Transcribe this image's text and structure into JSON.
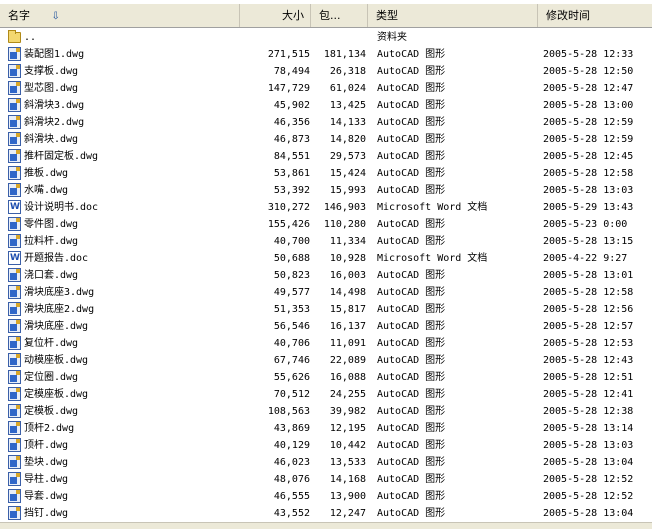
{
  "columns": {
    "name": "名字",
    "size": "大小",
    "packed": "包...",
    "type": "类型",
    "modified": "修改时间"
  },
  "files": [
    {
      "icon": "folder-icon",
      "kind": "folder",
      "name": "..",
      "size": "",
      "packed": "",
      "type": "资料夹",
      "modified": ""
    },
    {
      "icon": "dwg-file-icon",
      "kind": "dwg",
      "name": "装配图1.dwg",
      "size": "271,515",
      "packed": "181,134",
      "type": "AutoCAD 图形",
      "modified": "2005-5-28 12:33"
    },
    {
      "icon": "dwg-file-icon",
      "kind": "dwg",
      "name": "支撑板.dwg",
      "size": "78,494",
      "packed": "26,318",
      "type": "AutoCAD 图形",
      "modified": "2005-5-28 12:50"
    },
    {
      "icon": "dwg-file-icon",
      "kind": "dwg",
      "name": "型芯图.dwg",
      "size": "147,729",
      "packed": "61,024",
      "type": "AutoCAD 图形",
      "modified": "2005-5-28 12:47"
    },
    {
      "icon": "dwg-file-icon",
      "kind": "dwg",
      "name": "斜滑块3.dwg",
      "size": "45,902",
      "packed": "13,425",
      "type": "AutoCAD 图形",
      "modified": "2005-5-28 13:00"
    },
    {
      "icon": "dwg-file-icon",
      "kind": "dwg",
      "name": "斜滑块2.dwg",
      "size": "46,356",
      "packed": "14,133",
      "type": "AutoCAD 图形",
      "modified": "2005-5-28 12:59"
    },
    {
      "icon": "dwg-file-icon",
      "kind": "dwg",
      "name": "斜滑块.dwg",
      "size": "46,873",
      "packed": "14,820",
      "type": "AutoCAD 图形",
      "modified": "2005-5-28 12:59"
    },
    {
      "icon": "dwg-file-icon",
      "kind": "dwg",
      "name": "推杆固定板.dwg",
      "size": "84,551",
      "packed": "29,573",
      "type": "AutoCAD 图形",
      "modified": "2005-5-28 12:45"
    },
    {
      "icon": "dwg-file-icon",
      "kind": "dwg",
      "name": "推板.dwg",
      "size": "53,861",
      "packed": "15,424",
      "type": "AutoCAD 图形",
      "modified": "2005-5-28 12:58"
    },
    {
      "icon": "dwg-file-icon",
      "kind": "dwg",
      "name": "水嘴.dwg",
      "size": "53,392",
      "packed": "15,993",
      "type": "AutoCAD 图形",
      "modified": "2005-5-28 13:03"
    },
    {
      "icon": "word-file-icon",
      "kind": "doc",
      "name": "设计说明书.doc",
      "size": "310,272",
      "packed": "146,903",
      "type": "Microsoft Word 文档",
      "modified": "2005-5-29 13:43"
    },
    {
      "icon": "dwg-file-icon",
      "kind": "dwg",
      "name": "零件图.dwg",
      "size": "155,426",
      "packed": "110,280",
      "type": "AutoCAD 图形",
      "modified": "2005-5-23 0:00"
    },
    {
      "icon": "dwg-file-icon",
      "kind": "dwg",
      "name": "拉料杆.dwg",
      "size": "40,700",
      "packed": "11,334",
      "type": "AutoCAD 图形",
      "modified": "2005-5-28 13:15"
    },
    {
      "icon": "word-file-icon",
      "kind": "doc",
      "name": "开题报告.doc",
      "size": "50,688",
      "packed": "10,928",
      "type": "Microsoft Word 文档",
      "modified": "2005-4-22 9:27"
    },
    {
      "icon": "dwg-file-icon",
      "kind": "dwg",
      "name": "浇口套.dwg",
      "size": "50,823",
      "packed": "16,003",
      "type": "AutoCAD 图形",
      "modified": "2005-5-28 13:01"
    },
    {
      "icon": "dwg-file-icon",
      "kind": "dwg",
      "name": "滑块底座3.dwg",
      "size": "49,577",
      "packed": "14,498",
      "type": "AutoCAD 图形",
      "modified": "2005-5-28 12:58"
    },
    {
      "icon": "dwg-file-icon",
      "kind": "dwg",
      "name": "滑块底座2.dwg",
      "size": "51,353",
      "packed": "15,817",
      "type": "AutoCAD 图形",
      "modified": "2005-5-28 12:56"
    },
    {
      "icon": "dwg-file-icon",
      "kind": "dwg",
      "name": "滑块底座.dwg",
      "size": "56,546",
      "packed": "16,137",
      "type": "AutoCAD 图形",
      "modified": "2005-5-28 12:57"
    },
    {
      "icon": "dwg-file-icon",
      "kind": "dwg",
      "name": "复位杆.dwg",
      "size": "40,706",
      "packed": "11,091",
      "type": "AutoCAD 图形",
      "modified": "2005-5-28 12:53"
    },
    {
      "icon": "dwg-file-icon",
      "kind": "dwg",
      "name": "动模座板.dwg",
      "size": "67,746",
      "packed": "22,089",
      "type": "AutoCAD 图形",
      "modified": "2005-5-28 12:43"
    },
    {
      "icon": "dwg-file-icon",
      "kind": "dwg",
      "name": "定位圈.dwg",
      "size": "55,626",
      "packed": "16,088",
      "type": "AutoCAD 图形",
      "modified": "2005-5-28 12:51"
    },
    {
      "icon": "dwg-file-icon",
      "kind": "dwg",
      "name": "定模座板.dwg",
      "size": "70,512",
      "packed": "24,255",
      "type": "AutoCAD 图形",
      "modified": "2005-5-28 12:41"
    },
    {
      "icon": "dwg-file-icon",
      "kind": "dwg",
      "name": "定模板.dwg",
      "size": "108,563",
      "packed": "39,982",
      "type": "AutoCAD 图形",
      "modified": "2005-5-28 12:38"
    },
    {
      "icon": "dwg-file-icon",
      "kind": "dwg",
      "name": "顶杆2.dwg",
      "size": "43,869",
      "packed": "12,195",
      "type": "AutoCAD 图形",
      "modified": "2005-5-28 13:14"
    },
    {
      "icon": "dwg-file-icon",
      "kind": "dwg",
      "name": "顶杆.dwg",
      "size": "40,129",
      "packed": "10,442",
      "type": "AutoCAD 图形",
      "modified": "2005-5-28 13:03"
    },
    {
      "icon": "dwg-file-icon",
      "kind": "dwg",
      "name": "垫块.dwg",
      "size": "46,023",
      "packed": "13,533",
      "type": "AutoCAD 图形",
      "modified": "2005-5-28 13:04"
    },
    {
      "icon": "dwg-file-icon",
      "kind": "dwg",
      "name": "导柱.dwg",
      "size": "48,076",
      "packed": "14,168",
      "type": "AutoCAD 图形",
      "modified": "2005-5-28 12:52"
    },
    {
      "icon": "dwg-file-icon",
      "kind": "dwg",
      "name": "导套.dwg",
      "size": "46,555",
      "packed": "13,900",
      "type": "AutoCAD 图形",
      "modified": "2005-5-28 12:52"
    },
    {
      "icon": "dwg-file-icon",
      "kind": "dwg",
      "name": "挡钉.dwg",
      "size": "43,552",
      "packed": "12,247",
      "type": "AutoCAD 图形",
      "modified": "2005-5-28 13:04"
    }
  ]
}
